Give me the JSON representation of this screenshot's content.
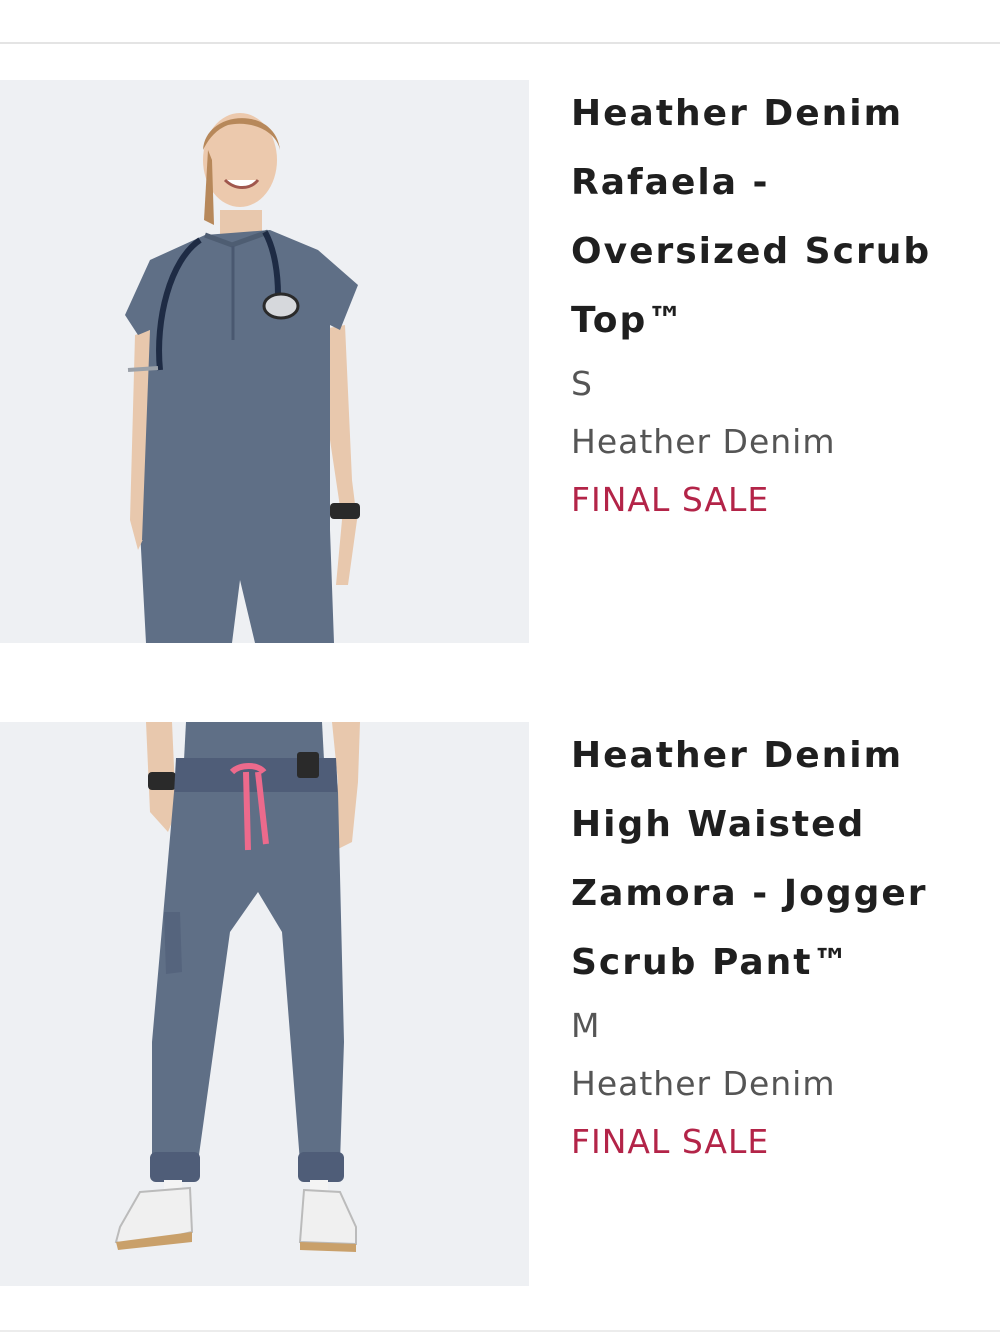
{
  "cart": {
    "items": [
      {
        "title_lines": [
          "Heather Denim",
          "Rafaela -",
          "Oversized Scrub",
          "Top™"
        ],
        "size": "S",
        "color": "Heather Denim",
        "sale_badge": "FINAL SALE",
        "image": "model-wearing-heather-denim-scrub-top-with-stethoscope"
      },
      {
        "title_lines": [
          "Heather Denim",
          "High Waisted",
          "Zamora - Jogger",
          "Scrub Pant™"
        ],
        "size": "M",
        "color": "Heather Denim",
        "sale_badge": "FINAL SALE",
        "image": "model-wearing-heather-denim-jogger-scrub-pants"
      }
    ]
  },
  "colors": {
    "sale": "#b32448",
    "title": "#1f1f1f",
    "meta": "#555555",
    "fabric": "#5f6f86"
  }
}
